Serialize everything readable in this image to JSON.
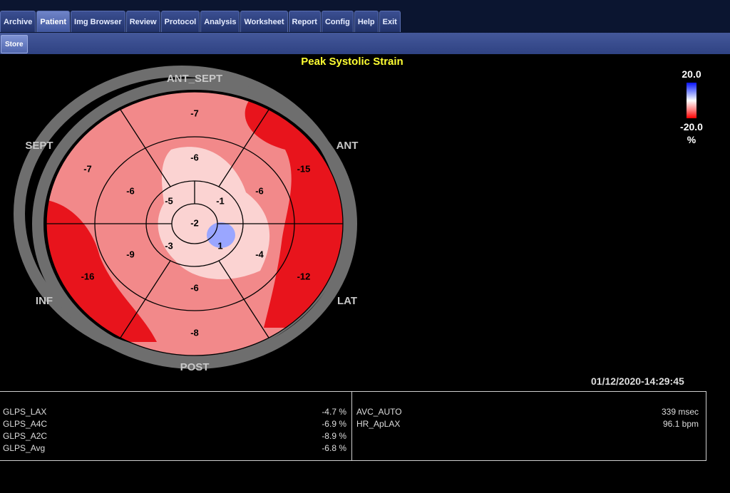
{
  "tabs": [
    {
      "label": "Archive",
      "active": false
    },
    {
      "label": "Patient",
      "active": true
    },
    {
      "label": "Img Browser",
      "active": false
    },
    {
      "label": "Review",
      "active": false
    },
    {
      "label": "Protocol",
      "active": false
    },
    {
      "label": "Analysis",
      "active": false
    },
    {
      "label": "Worksheet",
      "active": false
    },
    {
      "label": "Report",
      "active": false
    },
    {
      "label": "Config",
      "active": false
    },
    {
      "label": "Help",
      "active": false
    },
    {
      "label": "Exit",
      "active": false
    }
  ],
  "toolbar": {
    "store_label": "Store"
  },
  "chart": {
    "title": "Peak Systolic Strain",
    "walls": {
      "top": "ANT_SEPT",
      "upper_left": "SEPT",
      "upper_right": "ANT",
      "lower_left": "INF",
      "lower_right": "LAT",
      "bottom": "POST"
    },
    "segments": {
      "basal": [
        "-7",
        "-15",
        "-12",
        "-8",
        "-16",
        "-7"
      ],
      "mid": [
        "-6",
        "-6",
        "-4",
        "-6",
        "-9",
        "-6"
      ],
      "apical": [
        "-5",
        "-1",
        "1",
        "-3",
        "-5"
      ],
      "apex": "-2"
    }
  },
  "legend": {
    "max": "20.0",
    "min": "-20.0",
    "unit": "%"
  },
  "timestamp": "01/12/2020-14:29:45",
  "results": {
    "left": [
      {
        "name": "GLPS_LAX",
        "value": "-4.7 %"
      },
      {
        "name": "GLPS_A4C",
        "value": "-6.9 %"
      },
      {
        "name": "GLPS_A2C",
        "value": "-8.9 %"
      },
      {
        "name": "GLPS_Avg",
        "value": "-6.8 %"
      }
    ],
    "right": [
      {
        "name": "AVC_AUTO",
        "value": "339 msec"
      },
      {
        "name": "HR_ApLAX",
        "value": "96.1 bpm"
      }
    ]
  },
  "colors": {
    "tab_bar": "#0b1530",
    "sub_bar": "#36498c",
    "title": "#ffff33",
    "strain_strong": "#e8141c",
    "strain_mid": "#f2898a",
    "strain_weak": "#fbd3d2",
    "strain_positive": "#9aa6ff"
  }
}
